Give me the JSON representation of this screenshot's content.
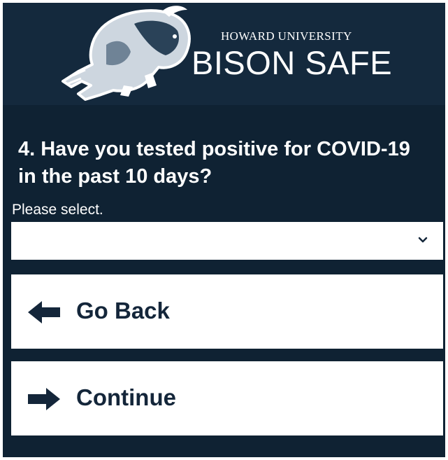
{
  "header": {
    "organization": "HOWARD UNIVERSITY",
    "app_name": "BISON SAFE",
    "logo_icon": "bison-mascot-icon"
  },
  "question": {
    "text": "4. Have you tested positive for COVID-19 in the past 10 days?"
  },
  "select": {
    "label": "Please select.",
    "value": ""
  },
  "buttons": {
    "back_label": "Go Back",
    "continue_label": "Continue"
  },
  "colors": {
    "background": "#0f2233",
    "banner": "#14293d",
    "text_on_dark": "#ffffff",
    "button_text": "#14263a"
  }
}
